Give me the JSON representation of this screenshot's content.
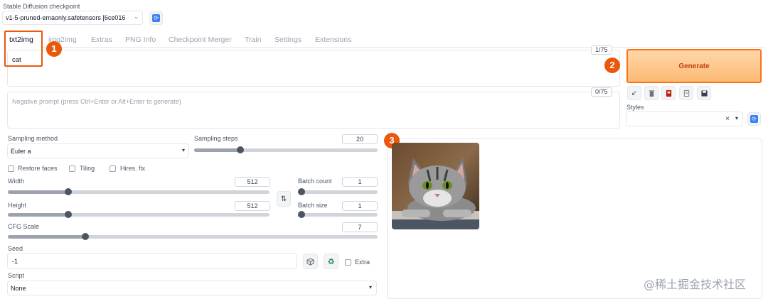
{
  "checkpoint": {
    "label": "Stable Diffusion checkpoint",
    "value": "v1-5-pruned-emaonly.safetensors [6ce016"
  },
  "tabs": [
    "txt2img",
    "img2img",
    "Extras",
    "PNG Info",
    "Checkpoint Merger",
    "Train",
    "Settings",
    "Extensions"
  ],
  "prompt": {
    "value": "cat",
    "token_count": "1/75"
  },
  "negative_prompt": {
    "placeholder": "Negative prompt (press Ctrl+Enter or Alt+Enter to generate)",
    "token_count": "0/75"
  },
  "generate_label": "Generate",
  "styles_label": "Styles",
  "styles_clear": "×",
  "sampling": {
    "method_label": "Sampling method",
    "method_value": "Euler a",
    "steps_label": "Sampling steps",
    "steps_value": "20",
    "steps_fraction": 0.25
  },
  "checkboxes": {
    "restore_faces": "Restore faces",
    "tiling": "Tiling",
    "hires_fix": "Hires. fix"
  },
  "width": {
    "label": "Width",
    "value": "512",
    "fraction": 0.23
  },
  "height": {
    "label": "Height",
    "value": "512",
    "fraction": 0.23
  },
  "batch_count": {
    "label": "Batch count",
    "value": "1",
    "fraction": 0.0
  },
  "batch_size": {
    "label": "Batch size",
    "value": "1",
    "fraction": 0.0
  },
  "cfg_scale": {
    "label": "CFG Scale",
    "value": "7",
    "fraction": 0.21
  },
  "seed": {
    "label": "Seed",
    "value": "-1",
    "extra_label": "Extra"
  },
  "script": {
    "label": "Script",
    "value": "None"
  },
  "callouts": [
    "1",
    "2",
    "3"
  ],
  "watermark": "@稀土掘金技术社区",
  "colors": {
    "accent": "#ea580c",
    "generate_bg_top": "#fed7aa",
    "generate_bg_bottom": "#fdba74",
    "refresh_blue": "#3b82f6"
  }
}
